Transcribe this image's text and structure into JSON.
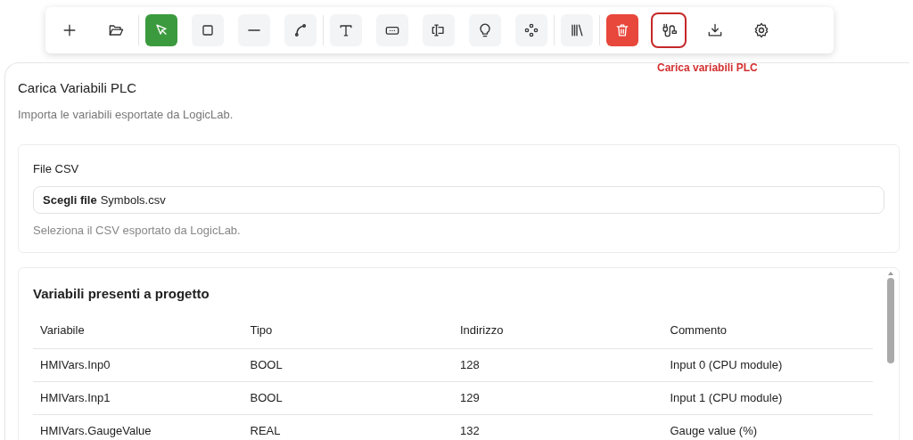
{
  "toolbar": {
    "groups": [
      [
        {
          "kind": "action",
          "highlighted": false
        },
        {
          "kind": "action",
          "highlighted": false
        }
      ],
      [
        {
          "kind": "tool",
          "selected": true,
          "highlighted": false
        },
        {
          "kind": "tool",
          "selected": false,
          "highlighted": false
        },
        {
          "kind": "tool",
          "selected": false,
          "highlighted": false
        },
        {
          "kind": "tool",
          "selected": false,
          "highlighted": false
        }
      ],
      [
        {
          "kind": "tool",
          "selected": false,
          "highlighted": false
        },
        {
          "kind": "tool",
          "selected": false,
          "highlighted": false
        },
        {
          "kind": "tool",
          "selected": false,
          "highlighted": false
        },
        {
          "kind": "tool",
          "selected": false,
          "highlighted": false
        },
        {
          "kind": "tool",
          "selected": false,
          "highlighted": false
        }
      ],
      [
        {
          "kind": "tool",
          "selected": false,
          "highlighted": false
        }
      ],
      [
        {
          "kind": "delete",
          "highlighted": false
        },
        {
          "kind": "action",
          "highlighted": true
        },
        {
          "kind": "action",
          "highlighted": false
        },
        {
          "kind": "action",
          "highlighted": false
        }
      ]
    ]
  },
  "tooltip": "Carica variabili PLC",
  "panel": {
    "title": "Carica Variabili PLC",
    "subtitle": "Importa le variabili esportate da LogicLab.",
    "file_section": {
      "label": "File CSV",
      "button": "Scegli file",
      "value": "Symbols.csv",
      "help": "Seleziona il CSV esportato da LogicLab."
    },
    "table": {
      "title": "Variabili presenti a progetto",
      "columns": [
        "Variabile",
        "Tipo",
        "Indirizzo",
        "Commento"
      ],
      "rows": [
        [
          "HMIVars.Inp0",
          "BOOL",
          "128",
          "Input 0 (CPU module)"
        ],
        [
          "HMIVars.Inp1",
          "BOOL",
          "129",
          "Input 1 (CPU module)"
        ],
        [
          "HMIVars.GaugeValue",
          "REAL",
          "132",
          "Gauge value (%)"
        ]
      ]
    }
  }
}
